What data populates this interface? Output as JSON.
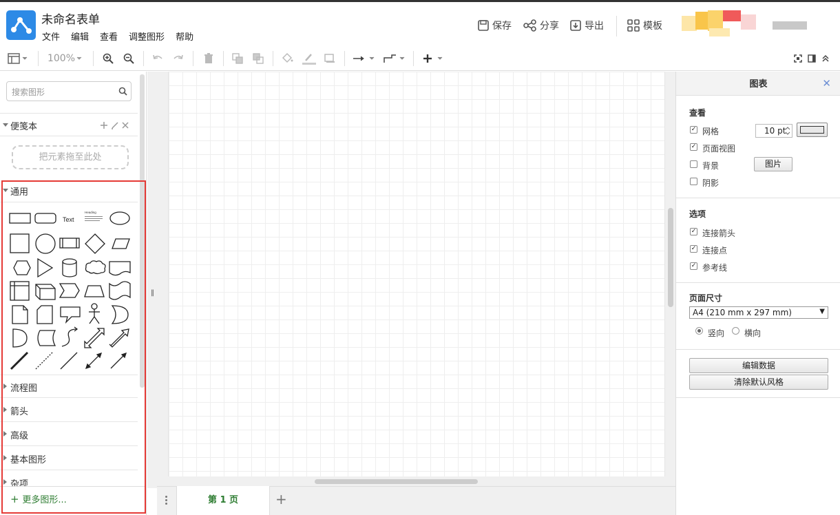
{
  "app": {
    "title": "未命名表单"
  },
  "menu": [
    "文件",
    "编辑",
    "查看",
    "调整图形",
    "帮助"
  ],
  "top_actions": {
    "save": "保存",
    "share": "分享",
    "export": "导出",
    "templates": "模板"
  },
  "toolbar": {
    "zoom": "100%"
  },
  "left": {
    "search_placeholder": "搜索图形",
    "scratchpad": {
      "label": "便笺本",
      "drop_hint": "把元素拖至此处"
    },
    "general": {
      "label": "通用",
      "text_shape": "Text",
      "heading_shape": "Heading"
    },
    "sections": [
      "流程图",
      "箭头",
      "高级",
      "基本图形",
      "杂项"
    ],
    "more_shapes": "更多图形..."
  },
  "canvas": {
    "page_tab": "第 1 页"
  },
  "right": {
    "title": "图表",
    "view": {
      "label": "查看",
      "grid": {
        "label": "网格",
        "checked": true,
        "size": "10 pt"
      },
      "page_view": {
        "label": "页面视图",
        "checked": true
      },
      "background": {
        "label": "背景",
        "checked": false,
        "image_button": "图片"
      },
      "shadow": {
        "label": "阴影",
        "checked": false
      }
    },
    "options": {
      "label": "选项",
      "connection_arrows": {
        "label": "连接箭头",
        "checked": true
      },
      "connection_points": {
        "label": "连接点",
        "checked": true
      },
      "guides": {
        "label": "参考线",
        "checked": true
      }
    },
    "page_size": {
      "label": "页面尺寸",
      "value": "A4 (210 mm x 297 mm)",
      "portrait": "竖向",
      "landscape": "横向",
      "orientation": "portrait"
    },
    "edit_data": "编辑数据",
    "clear_style": "清除默认风格"
  },
  "colors": {
    "accent_green": "#2e7d32",
    "logo_blue": "#2d8ae6",
    "highlight_red": "#e53935"
  }
}
